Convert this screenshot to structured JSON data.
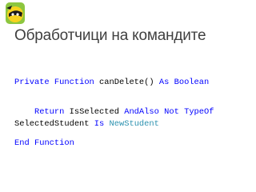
{
  "slide": {
    "title": "Обработчици на командите"
  },
  "code": {
    "line1": [
      {
        "t": "Private",
        "k": "kw"
      },
      {
        "t": " "
      },
      {
        "t": "Function",
        "k": "kw"
      },
      {
        "t": " canDelete() "
      },
      {
        "t": "As",
        "k": "kw"
      },
      {
        "t": " "
      },
      {
        "t": "Boolean",
        "k": "kw"
      }
    ],
    "line2": [
      {
        "t": "    "
      },
      {
        "t": "Return",
        "k": "kw"
      },
      {
        "t": " IsSelected "
      },
      {
        "t": "AndAlso",
        "k": "kw"
      },
      {
        "t": " "
      },
      {
        "t": "Not",
        "k": "kw"
      },
      {
        "t": " "
      },
      {
        "t": "TypeOf",
        "k": "kw"
      }
    ],
    "line3": [
      {
        "t": "SelectedStudent "
      },
      {
        "t": "Is",
        "k": "kw"
      },
      {
        "t": " "
      },
      {
        "t": "NewStudent",
        "k": "tp"
      }
    ],
    "line4": [
      {
        "t": "End",
        "k": "kw"
      },
      {
        "t": " "
      },
      {
        "t": "Function",
        "k": "kw"
      }
    ]
  },
  "colors": {
    "keyword": "#0000ff",
    "type": "#2b91af",
    "title": "#404040"
  },
  "icons": {
    "logo": "telerik-academy-ninja-logo"
  }
}
